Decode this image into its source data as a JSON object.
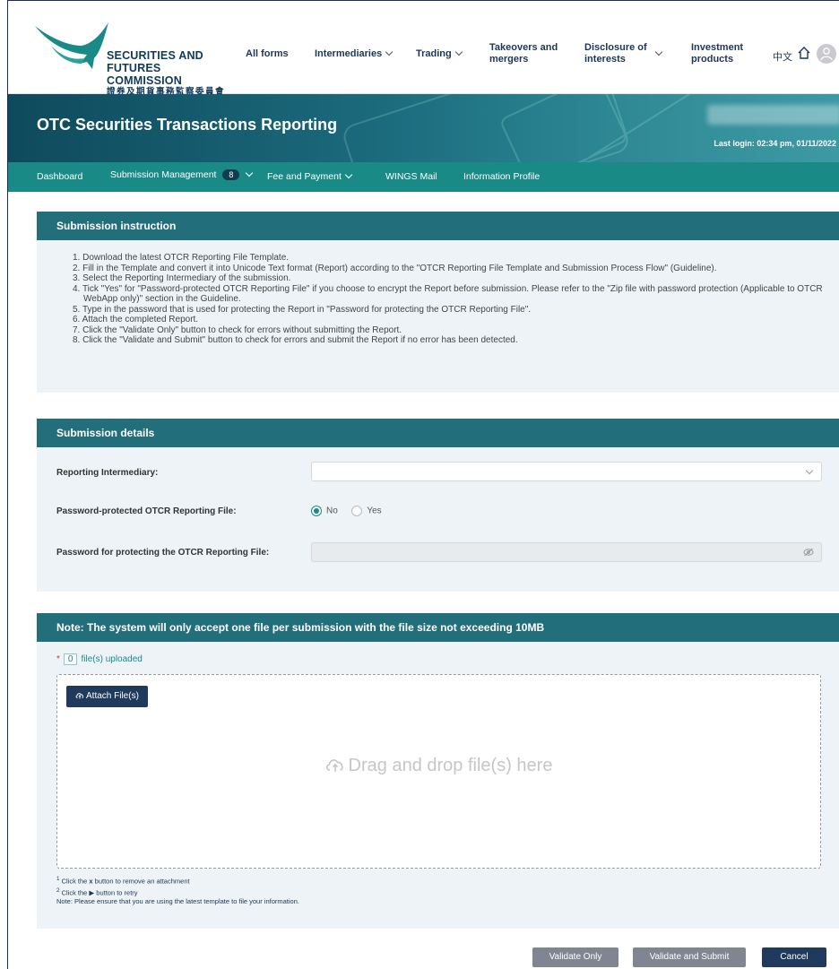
{
  "header": {
    "logo": {
      "line1": "SECURITIES AND",
      "line2": "FUTURES COMMISSION",
      "line3": "證券及期貨事務監察委員會"
    },
    "nav": [
      {
        "label": "All forms"
      },
      {
        "label": "Intermediaries"
      },
      {
        "label": "Trading"
      },
      {
        "label": "Takeovers and mergers"
      },
      {
        "label": "Disclosure of interests"
      },
      {
        "label": "Investment products"
      }
    ],
    "language": "中文"
  },
  "banner": {
    "title": "OTC Securities Transactions Reporting",
    "last_login": "Last login: 02:34 pm, 01/11/2022"
  },
  "subnav": {
    "dashboard": "Dashboard",
    "submission_management": "Submission Management",
    "submission_count": "8",
    "fee_payment": "Fee and Payment",
    "wings_mail": "WINGS Mail",
    "information_profile": "Information Profile"
  },
  "instructions": {
    "title": "Submission instruction",
    "items": [
      "1. Download the latest OTCR Reporting File Template.",
      "2. Fill in the Template and convert it into Unicode Text format (Report) according to the \"OTCR Reporting File Template and Submission Process Flow\" (Guideline).",
      "3. Select the Reporting Intermediary of the submission.",
      "4. Tick \"Yes\" for \"Password-protected OTCR Reporting File\" if you choose to encrypt the Report before submission. Please refer to the \"Zip file with password protection (Applicable to OTCR WebApp only)\" section in the Guideline.",
      "5. Type in the password that is used for protecting the Report in \"Password for protecting the OTCR Reporting File\".",
      "6. Attach the completed Report.",
      "7. Click the \"Validate Only\" button to check for errors without submitting the Report.",
      "8. Click the \"Validate and Submit\" button to check for errors and submit the Report if no error has been detected."
    ]
  },
  "details": {
    "title": "Submission details",
    "reporting_intermediary_label": "Reporting Intermediary:",
    "reporting_intermediary_value": "",
    "password_protected_label": "Password-protected OTCR Reporting File:",
    "option_no": "No",
    "option_yes": "Yes",
    "selected": "No",
    "password_label": "Password for protecting the OTCR Reporting File:"
  },
  "upload": {
    "title": "Note: The system will only accept one file per submission with the file size not exceeding 10MB",
    "required_mark": "*",
    "file_count": "0",
    "files_uploaded_label": "file(s) uploaded",
    "attach_label": "Attach File(s)",
    "drop_text": "Drag and drop file(s) here",
    "note1_sup": "1",
    "note1_pre": "Click the ",
    "note1_bold": "x",
    "note1_post": " button to remove an attachment",
    "note2_sup": "2",
    "note2_text": "Click the ▶ button to retry",
    "note3": "Note: Please ensure that you are using the latest template to file your information."
  },
  "actions": {
    "validate_only": "Validate Only",
    "validate_submit": "Validate and Submit",
    "cancel": "Cancel"
  },
  "colors": {
    "teal": "#1a8a87",
    "panel_header": "#236e7b",
    "navy": "#1f3a5c"
  }
}
